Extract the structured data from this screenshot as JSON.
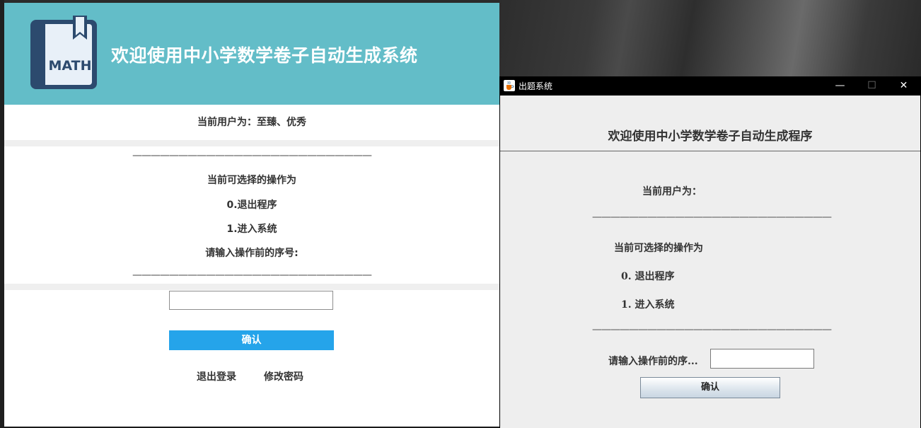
{
  "web": {
    "header_title": "欢迎使用中小学数学卷子自动生成系统",
    "logo_text": "MATH",
    "current_user": "当前用户为：至臻、优秀",
    "divider": "——————————————————————————",
    "menu_heading": "当前可选择的操作为",
    "option_0": "0.退出程序",
    "option_1": "1.进入系统",
    "prompt": "请输入操作前的序号:",
    "input_value": "",
    "confirm_label": "确认",
    "logout_label": "退出登录",
    "change_password_label": "修改密码",
    "header_color": "#63bdc8",
    "button_color": "#25a4ea"
  },
  "swing": {
    "window_title": "出题系统",
    "minimize": "—",
    "maximize": "☐",
    "close": "✕",
    "heading": "欢迎使用中小学数学卷子自动生成程序",
    "current_user": "当前用户为：",
    "divider": "——————————————————————————",
    "menu_heading": "当前可选择的操作为",
    "option_0": "0. 退出程序",
    "option_1": "1. 进入系统",
    "prompt": "请输入操作前的序...",
    "input_value": "",
    "confirm_label": "确认"
  }
}
